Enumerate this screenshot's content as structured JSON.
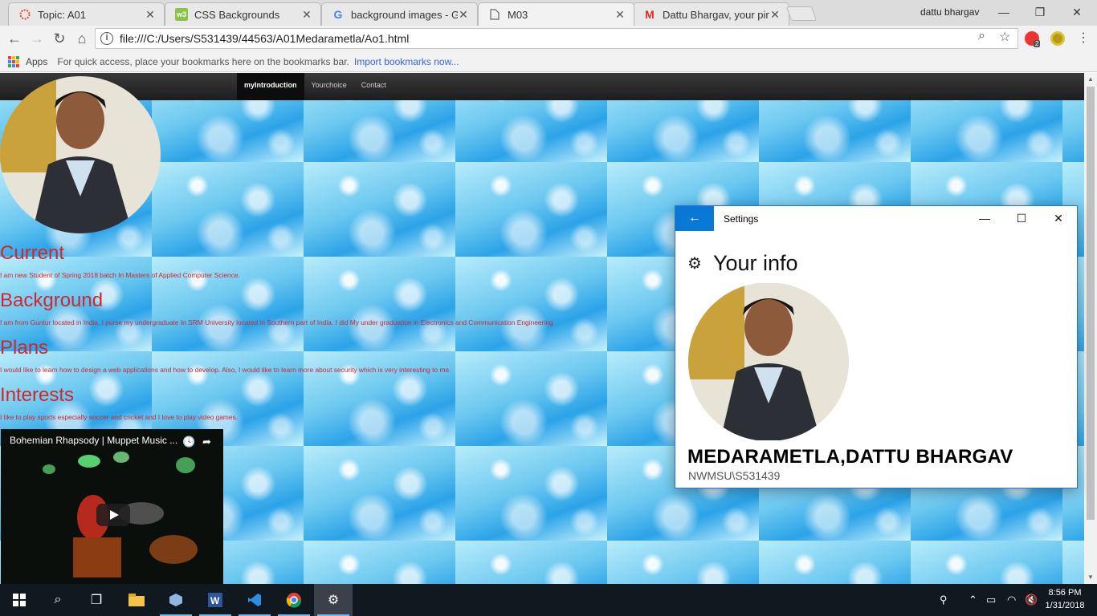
{
  "browser": {
    "tabs": [
      {
        "title": "Topic: A01",
        "icon": "topic-icon"
      },
      {
        "title": "CSS Backgrounds",
        "icon": "w3-icon"
      },
      {
        "title": "background images - Go",
        "icon": "google-icon"
      },
      {
        "title": "M03",
        "icon": "page-icon"
      },
      {
        "title": "Dattu Bhargav, your pin i",
        "icon": "gmail-icon"
      }
    ],
    "active_tab_index": 3,
    "user": "dattu bhargav",
    "url": "file:///C:/Users/S531439/44563/A01Medarametla/Ao1.html",
    "extension_badge": "2",
    "bookmarks": {
      "apps_label": "Apps",
      "hint": "For quick access, place your bookmarks here on the bookmarks bar.",
      "import_link": "Import bookmarks now..."
    }
  },
  "site": {
    "nav": [
      "myIntroduction",
      "Yourchoice",
      "Contact"
    ],
    "sections": [
      {
        "title": "Current",
        "text": "I am new Student of Spring 2018 batch In Masters of Applied Computer Science."
      },
      {
        "title": "Background",
        "text": "I am from Guntur located in India. I purse my undergraduate In SRM University located in Southern part of India. I did My under graduation in Electronics and Communication Engineering"
      },
      {
        "title": "Plans",
        "text": "I would like to learn how to design a web applications and how to develop. Also, I would like to learn more about security which is very interesting to me."
      },
      {
        "title": "Interests",
        "text": "I like to play sports especially soccer and cricket and I love to play video games."
      }
    ],
    "video_title": "Bohemian Rhapsody | Muppet Music ..."
  },
  "settings": {
    "window_title": "Settings",
    "heading": "Your info",
    "user_name": "MEDARAMETLA,DATTU BHARGAV",
    "account": "NWMSU\\S531439"
  },
  "taskbar": {
    "time": "8:56 PM",
    "date": "1/31/2018"
  },
  "colors": {
    "heading_red": "#d3262b",
    "settings_accent": "#0a78d7",
    "taskbar": "#101820"
  }
}
